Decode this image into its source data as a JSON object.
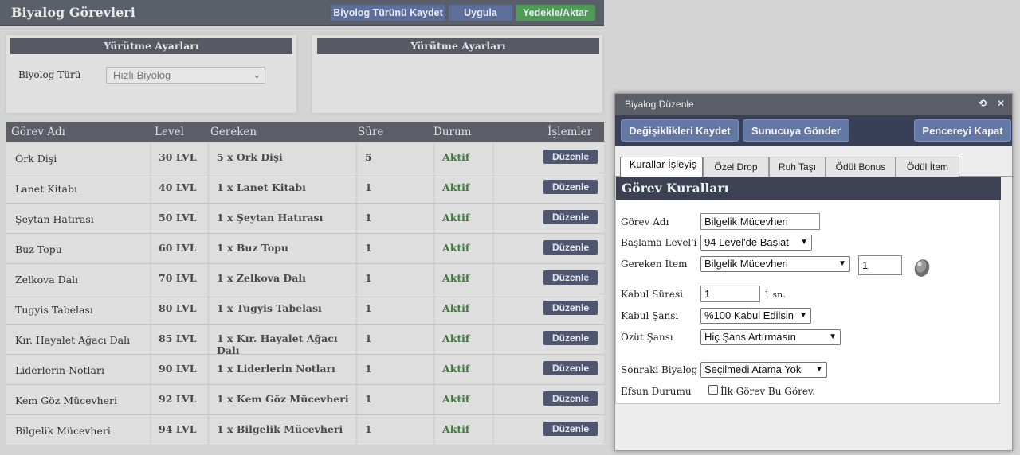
{
  "header": {
    "title": "Biyalog Görevleri",
    "buttons": {
      "save_type": "Biyolog Türünü Kaydet",
      "apply": "Uygula",
      "backup": "Yedekle/Aktar"
    }
  },
  "settings_left": {
    "title": "Yürütme Ayarları",
    "type_label": "Biyolog Türü",
    "type_value": "Hızlı Biyolog"
  },
  "settings_right": {
    "title": "Yürütme Ayarları"
  },
  "table": {
    "columns": [
      "Görev Adı",
      "Level",
      "Gereken",
      "Süre",
      "Durum",
      "İşlemler"
    ],
    "rows": [
      {
        "name": "Ork Dişi",
        "level": "30 LVL",
        "required": "5 x Ork Dişi",
        "time": "5",
        "status": "Aktif",
        "action": "Düzenle"
      },
      {
        "name": "Lanet Kitabı",
        "level": "40 LVL",
        "required": "1 x Lanet Kitabı",
        "time": "1",
        "status": "Aktif",
        "action": "Düzenle"
      },
      {
        "name": "Şeytan Hatırası",
        "level": "50 LVL",
        "required": "1 x Şeytan Hatırası",
        "time": "1",
        "status": "Aktif",
        "action": "Düzenle"
      },
      {
        "name": "Buz Topu",
        "level": "60 LVL",
        "required": "1 x Buz Topu",
        "time": "1",
        "status": "Aktif",
        "action": "Düzenle"
      },
      {
        "name": "Zelkova Dalı",
        "level": "70 LVL",
        "required": "1 x Zelkova Dalı",
        "time": "1",
        "status": "Aktif",
        "action": "Düzenle"
      },
      {
        "name": "Tugyis Tabelası",
        "level": "80 LVL",
        "required": "1 x Tugyis Tabelası",
        "time": "1",
        "status": "Aktif",
        "action": "Düzenle"
      },
      {
        "name": "Kır. Hayalet Ağacı Dalı",
        "level": "85 LVL",
        "required": "1 x Kır. Hayalet Ağacı Dalı",
        "time": "1",
        "status": "Aktif",
        "action": "Düzenle"
      },
      {
        "name": "Liderlerin Notları",
        "level": "90 LVL",
        "required": "1 x Liderlerin Notları",
        "time": "1",
        "status": "Aktif",
        "action": "Düzenle"
      },
      {
        "name": "Kem Göz Mücevheri",
        "level": "92 LVL",
        "required": "1 x Kem Göz Mücevheri",
        "time": "1",
        "status": "Aktif",
        "action": "Düzenle"
      },
      {
        "name": "Bilgelik Mücevheri",
        "level": "94 LVL",
        "required": "1 x Bilgelik Mücevheri",
        "time": "1",
        "status": "Aktif",
        "action": "Düzenle"
      }
    ]
  },
  "modal": {
    "title": "Biyalog Düzenle",
    "buttons": {
      "save": "Değişiklikleri Kaydet",
      "send": "Sunucuya Gönder",
      "close": "Pencereyi Kapat"
    },
    "tabs": [
      "Kurallar İşleyiş",
      "Özel Drop",
      "Ruh Taşı",
      "Ödül Bonus",
      "Ödül İtem"
    ],
    "section_title": "Görev Kuralları",
    "fields": {
      "name_label": "Görev Adı",
      "name_value": "Bilgelik Mücevheri",
      "start_label": "Başlama Level'i",
      "start_value": "94 Level'de Başlat",
      "item_label": "Gereken İtem",
      "item_value": "Bilgelik Mücevheri",
      "item_qty": "1",
      "accept_time_label": "Kabul Süresi",
      "accept_time_value": "1",
      "accept_time_unit": "1 sn.",
      "accept_chance_label": "Kabul Şansı",
      "accept_chance_value": "%100 Kabul Edilsin",
      "essence_label": "Özüt Şansı",
      "essence_value": "Hiç Şans Artırmasın",
      "next_label": "Sonraki Biyalog",
      "next_value": "Seçilmedi Atama Yok",
      "enchant_label": "Efsun Durumu",
      "enchant_check_label": "İlk Görev Bu Görev."
    }
  },
  "colors": {
    "accent_blue": "#6478a6",
    "active_green": "#3e7a3a",
    "header_dark": "#5b5e67"
  },
  "icons": {
    "refresh": "refresh-icon",
    "close": "close-icon",
    "item": "gem-icon"
  }
}
